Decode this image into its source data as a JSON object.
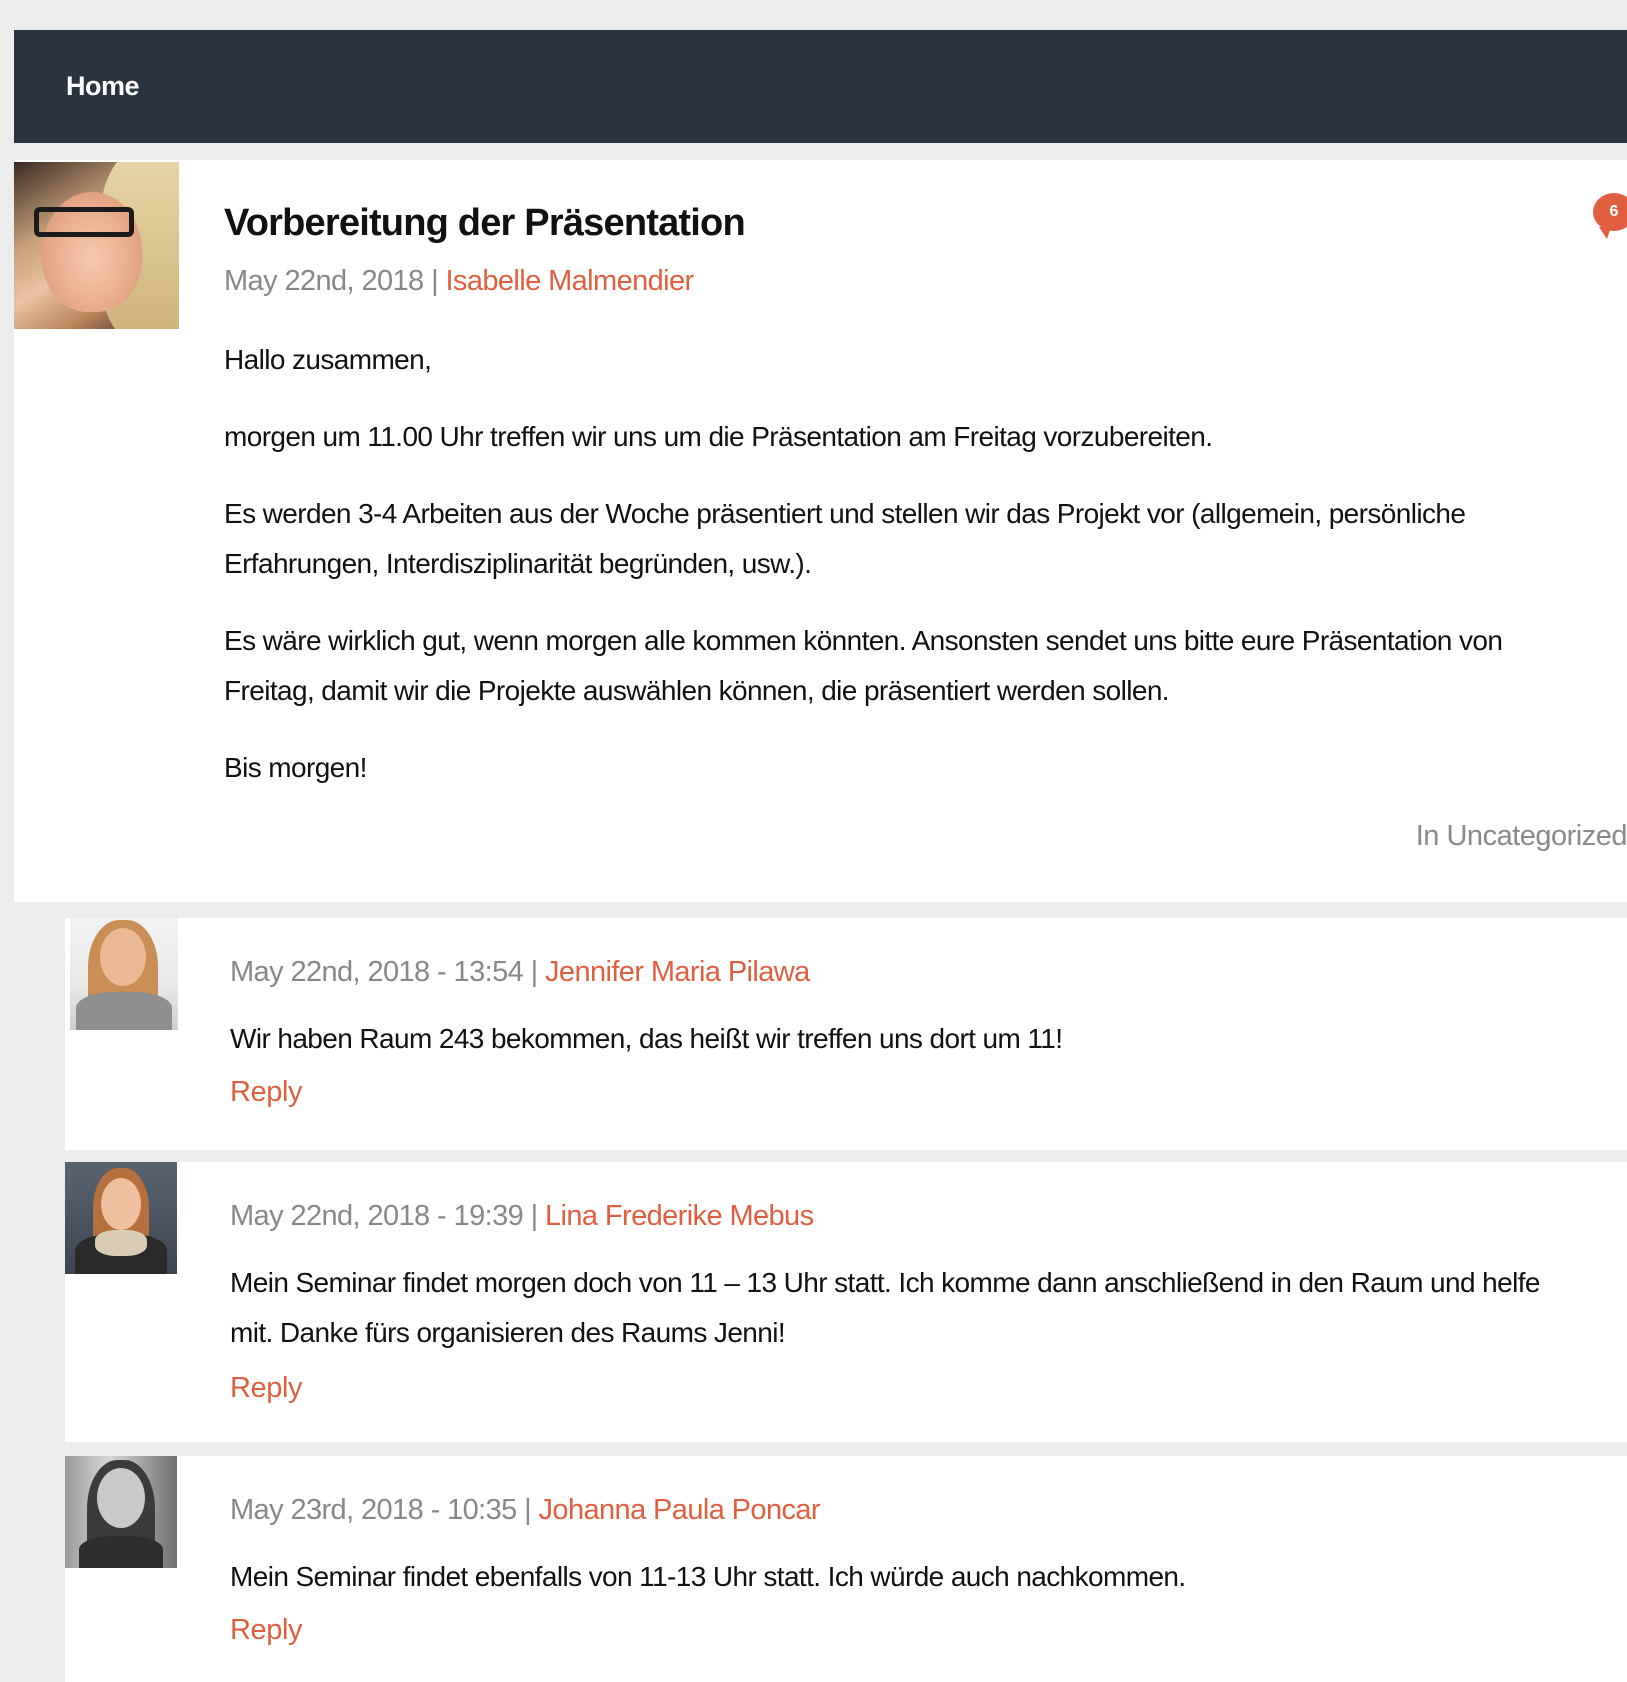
{
  "nav": {
    "home_label": "Home"
  },
  "post": {
    "title": "Vorbereitung der Präsentation",
    "date": "May 22nd, 2018",
    "separator": "|",
    "author": "Isabelle Malmendier",
    "comment_count": "6",
    "paragraphs": [
      "Hallo zusammen,",
      "morgen um 11.00 Uhr treffen wir uns um die Präsentation am Freitag vorzubereiten.",
      "Es werden 3-4 Arbeiten aus der Woche präsentiert und stellen wir das Projekt vor (allgemein, persönliche Erfahrungen, Interdisziplinarität begründen, usw.).",
      "Es wäre wirklich gut, wenn morgen alle kommen könnten. Ansonsten sendet uns bitte eure Präsentation von Freitag, damit wir die Projekte auswählen können, die präsentiert werden sollen.",
      "Bis morgen!"
    ],
    "category": "In Uncategorized"
  },
  "comments": [
    {
      "datetime": "May 22nd, 2018 - 13:54",
      "separator": "|",
      "author": "Jennifer Maria Pilawa",
      "text": "Wir haben Raum 243 bekommen, das heißt wir treffen uns dort um 11!",
      "reply_label": "Reply"
    },
    {
      "datetime": "May 22nd, 2018 - 19:39",
      "separator": "|",
      "author": "Lina Frederike Mebus",
      "text": "Mein Seminar findet morgen doch von 11 – 13 Uhr statt. Ich komme dann anschließend in den Raum und helfe mit. Danke fürs organisieren des Raums Jenni!",
      "reply_label": "Reply"
    },
    {
      "datetime": "May 23rd, 2018 - 10:35",
      "separator": "|",
      "author": "Johanna Paula Poncar",
      "text": "Mein Seminar findet ebenfalls von 11-13 Uhr statt. Ich würde auch nachkommen.",
      "reply_label": "Reply"
    }
  ],
  "colors": {
    "nav_bg": "#2a3440",
    "accent": "#e15f41",
    "meta_gray": "#888888",
    "page_bg": "#ececec"
  }
}
